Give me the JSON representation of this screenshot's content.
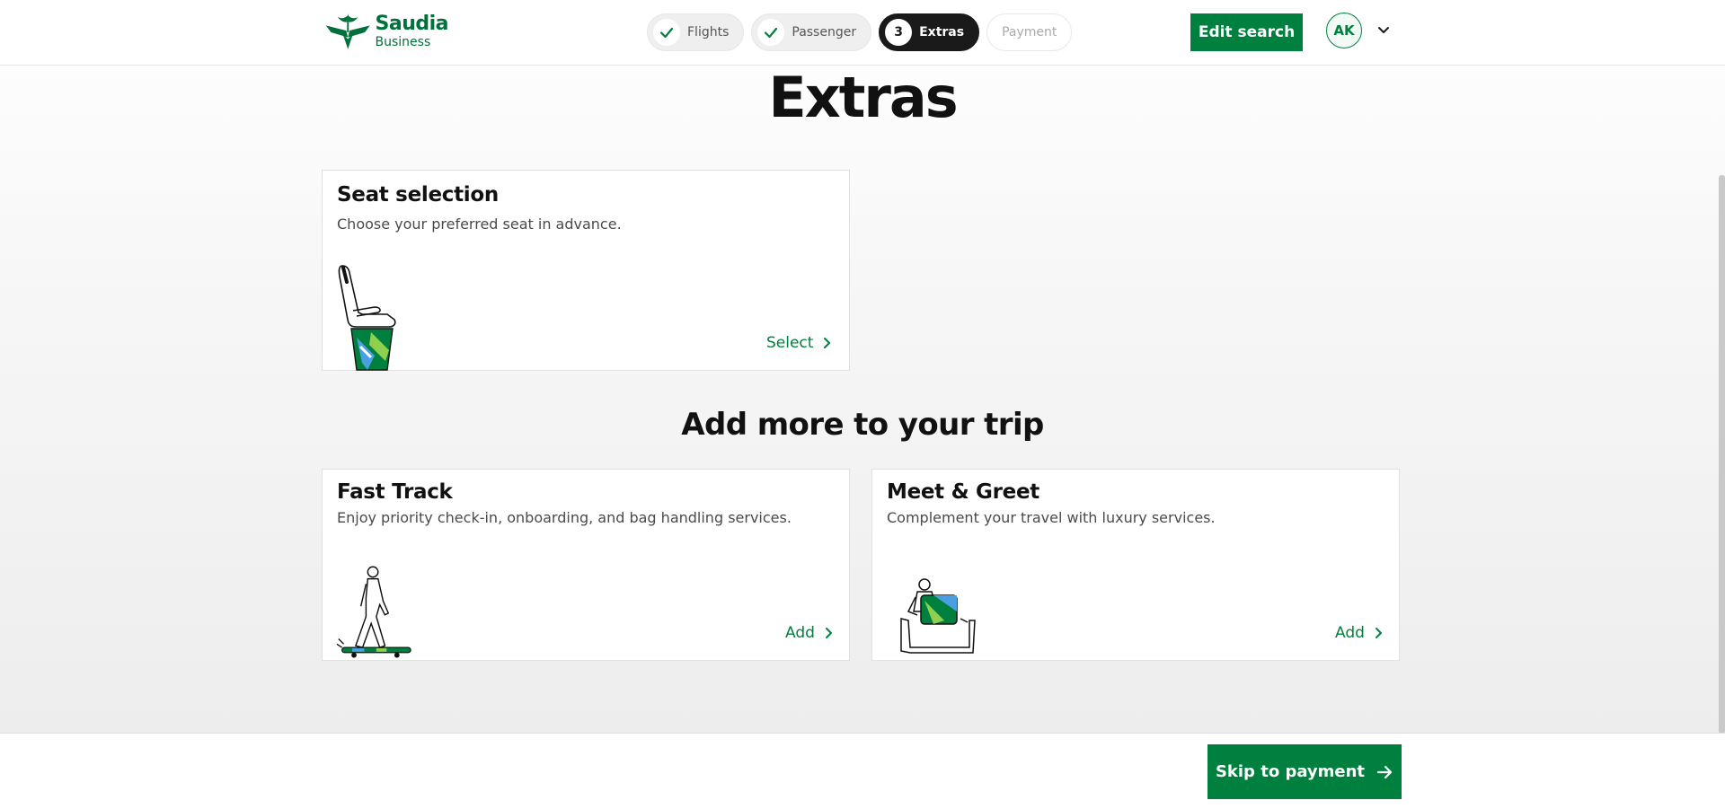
{
  "header": {
    "logo": {
      "brand": "Saudia",
      "sub": "Business"
    },
    "steps": [
      {
        "label": "Flights",
        "state": "done"
      },
      {
        "label": "Passenger",
        "state": "done"
      },
      {
        "number": "3",
        "label": "Extras",
        "state": "active"
      },
      {
        "label": "Payment",
        "state": "pending"
      }
    ],
    "edit_search_label": "Edit search",
    "avatar_initials": "AK"
  },
  "main": {
    "title": "Extras",
    "seat_card": {
      "title": "Seat selection",
      "description": "Choose your preferred seat in advance.",
      "action": "Select"
    },
    "section_title": "Add more to your trip",
    "fast_track_card": {
      "title": "Fast Track",
      "description": "Enjoy priority check-in, onboarding, and bag handling services.",
      "action": "Add"
    },
    "meet_greet_card": {
      "title": "Meet & Greet",
      "description": "Complement your travel with luxury services.",
      "action": "Add"
    }
  },
  "footer": {
    "skip_label": "Skip to payment"
  },
  "colors": {
    "brand_green": "#00803e",
    "active_step": "#1a1a1a"
  }
}
